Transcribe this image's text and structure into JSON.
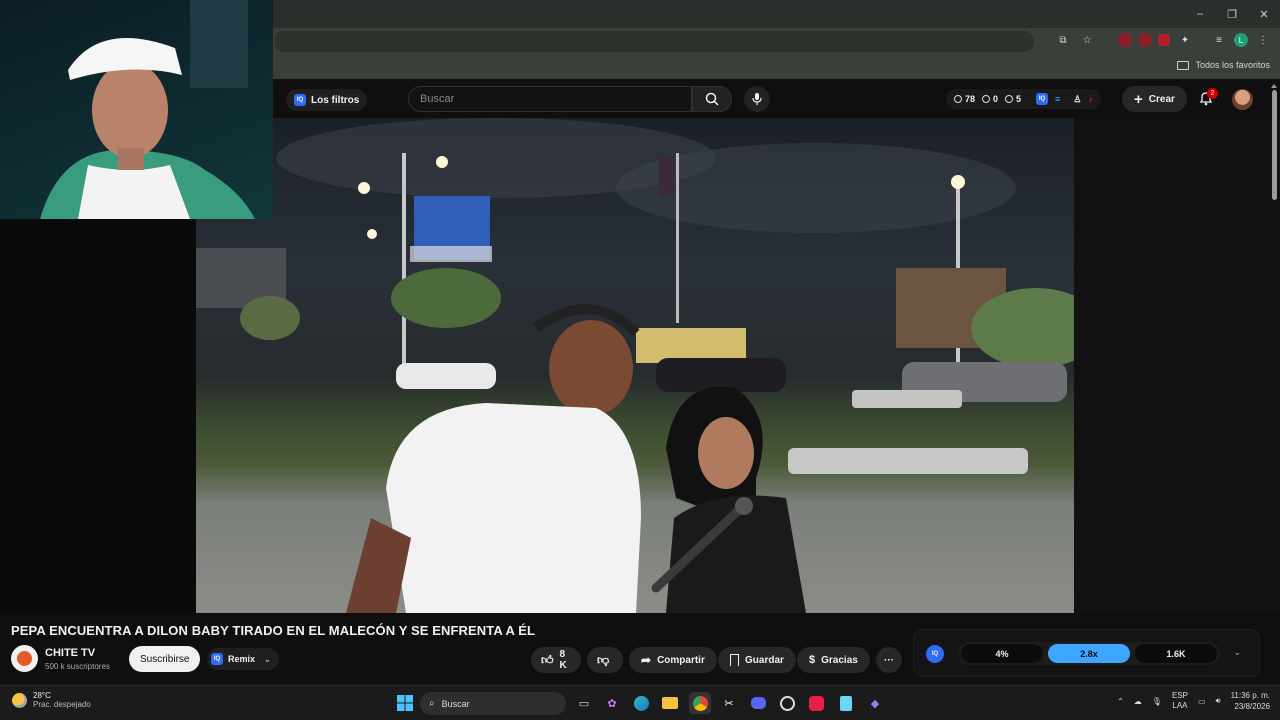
{
  "browser": {
    "window_controls": [
      "–",
      "❐",
      "✕"
    ],
    "bookmarks_all": "Todos los favoritos",
    "profile_initial": "L"
  },
  "yt": {
    "filters_label": "Los filtros",
    "search_placeholder": "Buscar",
    "stats": {
      "watch": "78",
      "views": "0",
      "second": "5"
    },
    "create_label": "Crear",
    "notif_count": "2"
  },
  "video": {
    "title": "PEPA ENCUENTRA A DILON BABY TIRADO EN EL MALECÓN Y SE ENFRENTA A ÉL",
    "channel_name": "CHITE TV",
    "subscribers": "500 k suscriptores",
    "subscribe_label": "Suscribirse",
    "remix_label": "Remix",
    "like_count": "8 K",
    "share_label": "Compartir",
    "save_label": "Guardar",
    "thanks_label": "Gracias",
    "more_label": "···"
  },
  "speed_panel": {
    "badge": "IQ",
    "options": [
      "4%",
      "2.8x",
      "1.6K"
    ],
    "active_index": 1
  },
  "taskbar": {
    "temperature": "28°C",
    "weather": "Prac. despejado",
    "search_label": "Buscar",
    "lang_top": "ESP",
    "lang_bottom": "LAA",
    "time": "11:36 p. m.",
    "date": "23/8/2026"
  },
  "colors": {
    "accent": "#3ea6ff",
    "brand_red": "#cc0000",
    "iq_blue": "#2e6cf6"
  }
}
